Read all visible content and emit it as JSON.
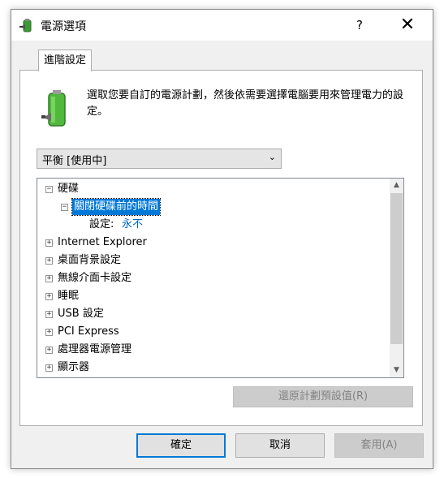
{
  "window": {
    "title": "電源選項",
    "help_label": "?",
    "close_label": "✕"
  },
  "tab": {
    "label": "進階設定"
  },
  "intro_text": "選取您要自訂的電源計劃，然後依需要選擇電腦要用來管理電力的設定。",
  "plan_select": {
    "value": "平衡 [使用中]"
  },
  "tree": {
    "items": [
      {
        "label": "硬碟",
        "expander": "−"
      },
      {
        "label": "關閉硬碟前的時間",
        "expander": "−"
      },
      {
        "setting_label": "設定:",
        "setting_value": "永不"
      },
      {
        "label": "Internet Explorer",
        "expander": "+"
      },
      {
        "label": "桌面背景設定",
        "expander": "+"
      },
      {
        "label": "無線介面卡設定",
        "expander": "+"
      },
      {
        "label": "睡眠",
        "expander": "+"
      },
      {
        "label": "USB 設定",
        "expander": "+"
      },
      {
        "label": "PCI Express",
        "expander": "+"
      },
      {
        "label": "處理器電源管理",
        "expander": "+"
      },
      {
        "label": "顯示器",
        "expander": "+"
      }
    ]
  },
  "buttons": {
    "restore": "還原計劃預設值(R)",
    "ok": "確定",
    "cancel": "取消",
    "apply": "套用(A)"
  },
  "colors": {
    "accent": "#0078d7",
    "setting_value": "#0066cc",
    "disabled_text": "#838383"
  }
}
